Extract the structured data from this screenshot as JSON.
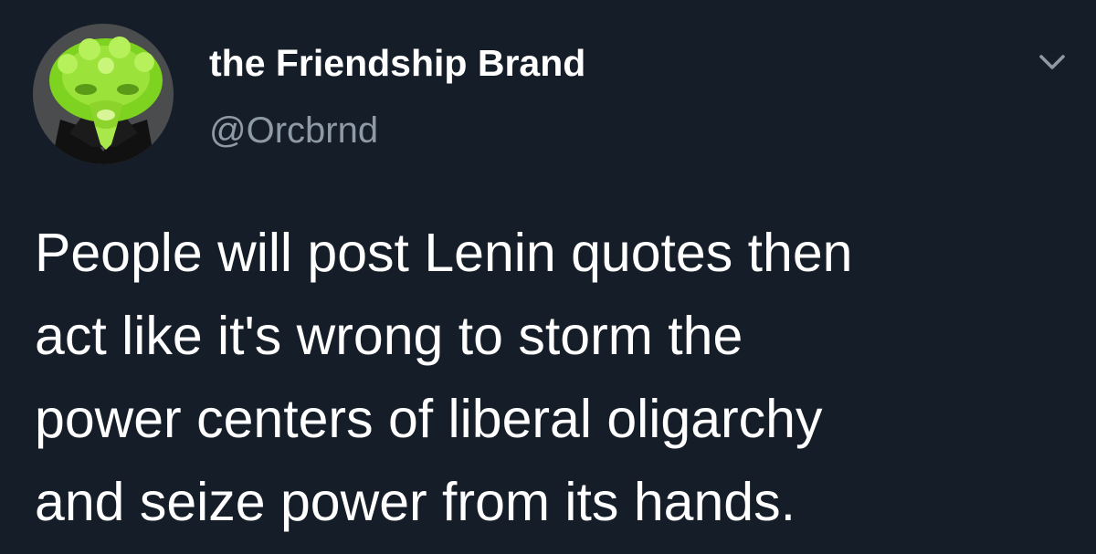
{
  "tweet": {
    "author": {
      "display_name": "the Friendship Brand",
      "handle": "@Orcbrnd",
      "avatar_icon": "green-orc-mask-avatar"
    },
    "menu_icon": "chevron-down-icon",
    "text": "People will post Lenin quotes then\nact like it's wrong to storm the\npower centers of liberal oligarchy\nand seize power from its hands."
  },
  "colors": {
    "background": "#151d28",
    "text_primary": "#ffffff",
    "text_secondary": "#8e9aa6"
  }
}
